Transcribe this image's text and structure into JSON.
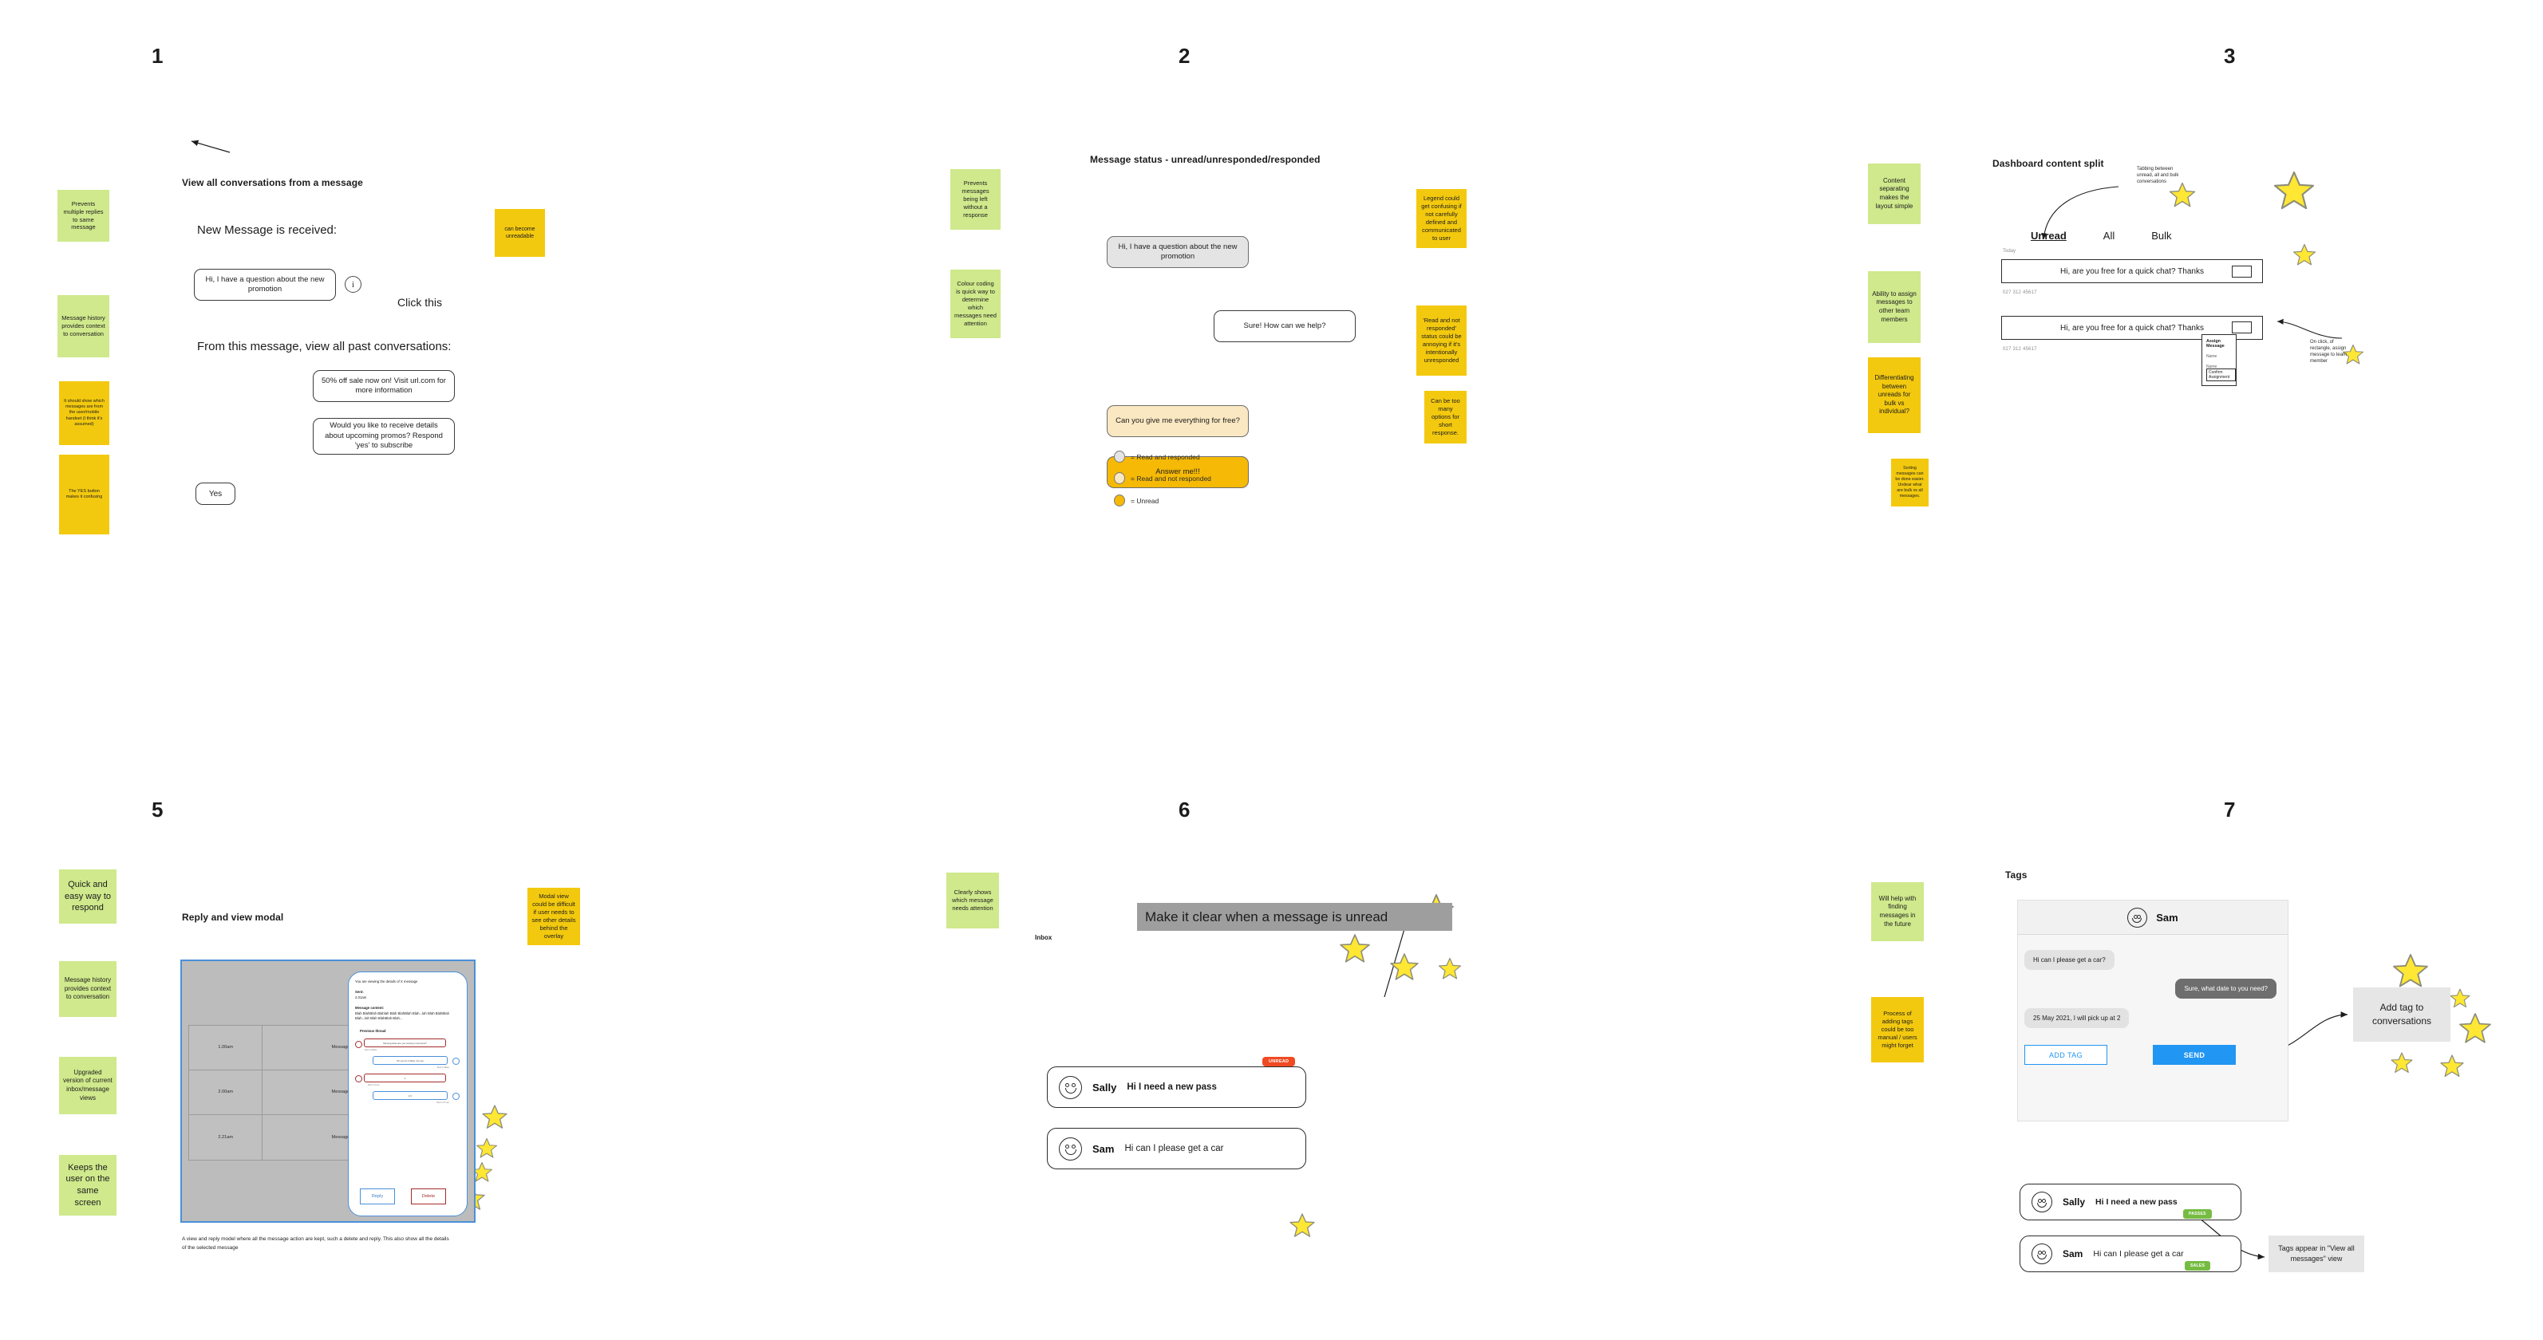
{
  "panels": {
    "p1": {
      "number": "1",
      "title": "View all conversations from a message",
      "label_new": "New Message is received:",
      "label_past": "From this message, view all past conversations:",
      "bubble_new": "Hi, I have a question about the new promotion",
      "info_icon_char": "i",
      "click_this": "Click this",
      "bubble_promo": "50% off sale now on! Visit url.com for more information",
      "bubble_subscribe": "Would you like to receive details about upcoming promos? Respond 'yes' to subscribe",
      "btn_yes": "Yes",
      "notes": [
        {
          "tone": "green",
          "text": "Prevents multiple replies to same message"
        },
        {
          "tone": "green",
          "text": "Message history provides context to conversation"
        },
        {
          "tone": "yellow",
          "text": "It should show which messages are from the user/mobile handset (I think it's assumed)"
        },
        {
          "tone": "yellow",
          "text": "The YES button makes it confusing"
        },
        {
          "tone": "yellow",
          "text": "can become unreadable"
        }
      ]
    },
    "p2": {
      "number": "2",
      "title": "Message status - unread/unresponded/responded",
      "bubbles": [
        {
          "tone": "grey",
          "text": "Hi, I have a question about the new promotion"
        },
        {
          "tone": "white",
          "text": "Sure! How can we help?"
        },
        {
          "tone": "cream",
          "text": "Can you give me everything for free?"
        },
        {
          "tone": "amber",
          "text": "Answer me!!!"
        }
      ],
      "legend": [
        {
          "color": "#e4e4e4",
          "label": "= Read and responded"
        },
        {
          "color": "#fae8c2",
          "label": "= Read and not responded"
        },
        {
          "color": "#f5b906",
          "label": "= Unread"
        }
      ],
      "notes": [
        {
          "tone": "green",
          "text": "Prevents messages being left without a response"
        },
        {
          "tone": "green",
          "text": "Colour coding is quick way to determine which messages need attention"
        },
        {
          "tone": "yellow",
          "text": "Legend could get confusing if not carefully defined and communicated to user"
        },
        {
          "tone": "yellow",
          "text": "'Read and not responded' status could be annoying if it's intentionally unresponded"
        },
        {
          "tone": "yellow",
          "text": "Can be too many options for short response."
        }
      ]
    },
    "p3": {
      "number": "3",
      "title": "Dashboard content split",
      "annot_tabbing": "Tabbing between unread, all and bulk conversations",
      "annot_onclick": "On click, of rectangle, assign message to team member",
      "tabs": [
        {
          "label": "Unread",
          "active": true
        },
        {
          "label": "All",
          "active": false
        },
        {
          "label": "Bulk",
          "active": false
        }
      ],
      "today_label": "Today",
      "rows": [
        {
          "text": "Hi, are you free for a quick chat? Thanks",
          "phone": "027 312 45617"
        },
        {
          "text": "Hi, are you free for a quick chat? Thanks",
          "phone": "027 312 45617"
        }
      ],
      "assign": {
        "title": "Assign Message",
        "name1": "Name",
        "name2": "Name",
        "confirm": "Confirm Assignment"
      },
      "notes": [
        {
          "tone": "green",
          "text": "Content separating makes the layout simple"
        },
        {
          "tone": "green",
          "text": "Ability to assign messages to other team members"
        },
        {
          "tone": "yellow",
          "text": "Differentiating between unreads for bulk vs individual?"
        },
        {
          "tone": "yellow",
          "text": "Sorting messages can be done easier. Undear what are bulk vs all messages."
        }
      ]
    },
    "p5": {
      "number": "5",
      "title": "Reply and view modal",
      "table": {
        "rows": [
          {
            "time": "1.00am",
            "text": "Message text"
          },
          {
            "time": "2.00am",
            "text": "Message text"
          },
          {
            "time": "2.21am",
            "text": "Message text"
          }
        ]
      },
      "modal": {
        "heading": "You are viewing the details of X message",
        "sent_label": "Sent:",
        "sent_value": "2.01am",
        "content_label": "Message content:",
        "content_value": "Blah BlahBlah Blahlah Blah BlahBlah Blah...lah Blah BlahBlah Blah...lah Blah BlahBlah Blah...",
        "thread_label": "Previous thread",
        "thread": [
          {
            "side": "in",
            "text": "Morning when are you coming in tomorrow?",
            "sent": "Sent 1.00am"
          },
          {
            "side": "out",
            "text": "Oh yes it's 1.00am, but yes",
            "sent": "Sent 1.30am"
          },
          {
            "side": "in",
            "text": "k",
            "sent": "Sent 1.4 am"
          },
          {
            "side": "out",
            "text": "zzz",
            "sent": "Sent 1.27 am"
          }
        ],
        "btn_reply": "Reply",
        "btn_delete": "Delete"
      },
      "caption": "A view and reply model where all the message action are kept, such a delete and reply. This also show all the details of the selected message",
      "notes": [
        {
          "tone": "green",
          "text": "Quick and easy way to respond"
        },
        {
          "tone": "green",
          "text": "Message history provides context to conversation"
        },
        {
          "tone": "green",
          "text": "Upgraded version of current inbox/message views"
        },
        {
          "tone": "green",
          "text": "Keeps the user on the same screen"
        },
        {
          "tone": "yellow",
          "text": "Modal view could be difficult if user needs to see other details behind the overlay"
        }
      ]
    },
    "p6": {
      "number": "6",
      "banner": "Make it clear when a message is unread",
      "inbox_label": "Inbox",
      "unread_badge": "UNREAD",
      "cards": [
        {
          "name": "Sally",
          "msg": "Hi I need a new pass",
          "bold": true,
          "unread": true
        },
        {
          "name": "Sam",
          "msg": "Hi can I please get a car",
          "bold": false,
          "unread": false
        }
      ],
      "notes": [
        {
          "tone": "green",
          "text": "Clearly shows which message needs attention"
        }
      ]
    },
    "p7": {
      "number": "7",
      "title": "Tags",
      "chat": {
        "contact": "Sam",
        "bubbles": [
          {
            "side": "in",
            "text": "Hi can I please get a car?"
          },
          {
            "side": "out",
            "text": "Sure, what date to you need?"
          },
          {
            "side": "in",
            "text": "25 May 2021, I will pick up at 2"
          }
        ],
        "btn_addtag": "ADD TAG",
        "btn_send": "SEND"
      },
      "callout_addtag": "Add tag to conversations",
      "callout_tagsappear": "Tags appear in \"View all messages\" view",
      "cards": [
        {
          "name": "Sally",
          "msg": "Hi I need a new pass",
          "bold": true,
          "tag": "PASSES"
        },
        {
          "name": "Sam",
          "msg": "Hi can I please get a car",
          "bold": false,
          "tag": "SALES"
        }
      ],
      "notes": [
        {
          "tone": "green",
          "text": "Will help with finding messages in the future"
        },
        {
          "tone": "yellow",
          "text": "Process of adding tags could be too manual / users might forget"
        }
      ]
    }
  },
  "colors": {
    "note_green": "#cfe98c",
    "note_yellow": "#f3c90f",
    "star": "#ffe734",
    "unread_red": "#f04a23",
    "tag_green": "#76bc43",
    "accent_blue": "#2196f3"
  }
}
